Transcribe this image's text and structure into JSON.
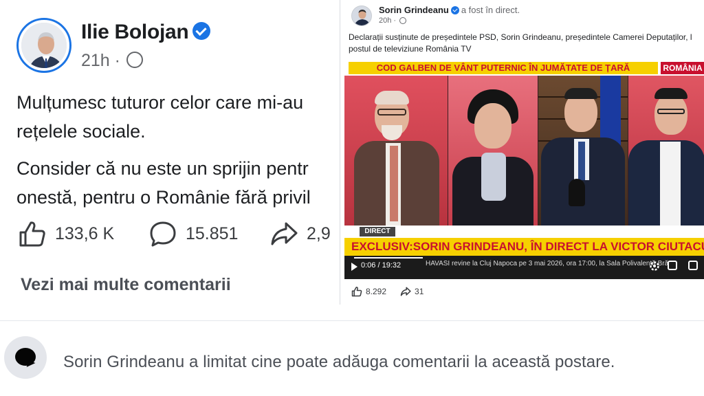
{
  "left_post": {
    "author": "Ilie Bolojan",
    "time": "21h",
    "separator": "·",
    "paragraph1_line1": "Mulțumesc tuturor celor care mi-au",
    "paragraph1_line2": "rețelele sociale.",
    "paragraph2_line1": "Consider că nu este un sprijin pentr",
    "paragraph2_line2": "onestă, pentru o Românie fără privil",
    "likes": "133,6 K",
    "comments": "15.851",
    "shares": "2,9",
    "more_comments": "Vezi mai multe comentarii"
  },
  "right_post": {
    "author": "Sorin Grindeanu",
    "status": "a fost în direct.",
    "time": "20h",
    "separator": "·",
    "caption_line1": "Declarații susținute de președintele PSD, Sorin Grindeanu, președintele Camerei Deputaților, l",
    "caption_line2": "postul de televiziune România TV",
    "video": {
      "top_ticker": "COD GALBEN DE VÂNT PUTERNIC ÎN JUMĂTATE DE ȚARĂ",
      "channel_logo": "ROMÂNIA",
      "direct_label": "DIRECT",
      "main_ticker": "EXCLUSIV:SORIN GRINDEANU, ÎN DIRECT LA VICTOR CIUTACU",
      "time": "0:06 / 19:32",
      "news_crawl": "HAVASI revine la Cluj Napoca pe 3 mai 2026, ora 17:00, la Sala Polivalentă Bră",
      "progress_fraction": 0.005
    },
    "reactions": "8.292",
    "shares": "31"
  },
  "bottom": {
    "notice": "Sorin Grindeanu a limitat cine poate adăuga comentarii la această postare."
  },
  "colors": {
    "facebook_blue": "#1b74e4",
    "ticker_yellow": "#f6d000",
    "ticker_red": "#c8102e",
    "muted_text": "#65676b"
  },
  "icons": [
    "verified-badge-icon",
    "globe-icon",
    "like-icon",
    "comment-icon",
    "share-icon",
    "play-icon",
    "settings-icon",
    "fullscreen-icon",
    "comment-bubble-icon"
  ]
}
